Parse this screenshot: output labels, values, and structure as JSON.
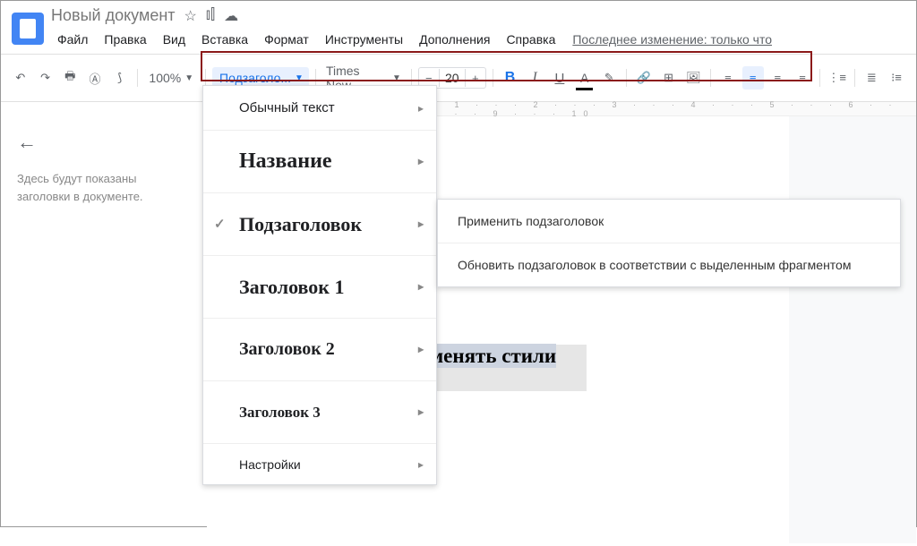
{
  "doc": {
    "title": "Новый документ"
  },
  "menubar": [
    "Файл",
    "Правка",
    "Вид",
    "Вставка",
    "Формат",
    "Инструменты",
    "Дополнения",
    "Справка"
  ],
  "last_change": "Последнее изменение: только что",
  "toolbar": {
    "zoom": "100%",
    "style_label": "Подзаголо...",
    "font_label": "Times New...",
    "font_size": "20"
  },
  "sidebar": {
    "text": "Здесь будут показаны заголовки в документе."
  },
  "style_menu": {
    "normal": "Обычный текст",
    "title": "Название",
    "subtitle": "Подзаголовок",
    "h1": "Заголовок 1",
    "h2": "Заголовок 2",
    "h3": "Заголовок 3",
    "settings": "Настройки"
  },
  "submenu": {
    "apply": "Применить подзаголовок",
    "update": "Обновить подзаголовок в соответствии с выделенным фрагментом"
  },
  "document": {
    "selected_text": "Как настроить и применять стили"
  }
}
